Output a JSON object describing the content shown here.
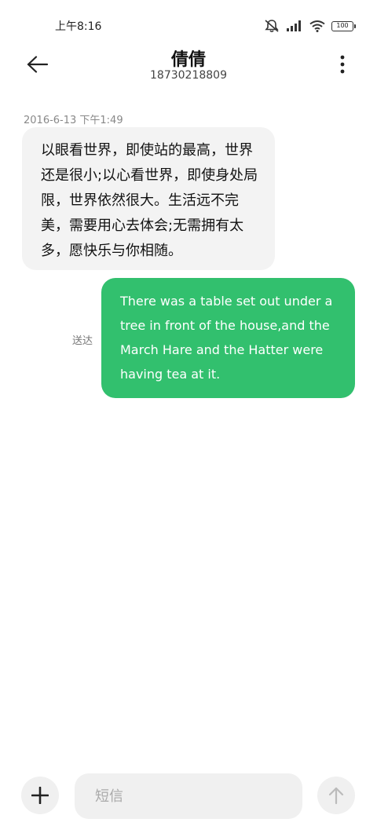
{
  "status_bar": {
    "time": "上午8:16",
    "battery": "100",
    "icons": [
      "mute-bell-icon",
      "signal-icon",
      "wifi-icon",
      "battery-icon"
    ]
  },
  "header": {
    "title": "倩倩",
    "subtitle": "18730218809",
    "back_icon": "back-arrow-icon",
    "menu_icon": "more-vertical-icon"
  },
  "conversation": {
    "timestamp": "2016-6-13 下午1:49",
    "messages": [
      {
        "direction": "incoming",
        "text": "以眼看世界，即使站的最高，世界还是很小;以心看世界，即使身处局限，世界依然很大。生活远不完美，需要用心去体会;无需拥有太多，愿快乐与你相随。"
      },
      {
        "direction": "outgoing",
        "status": "送达",
        "text": "There was a table set out under a tree in front of the house,and the March Hare and the Hatter were having tea at it."
      }
    ]
  },
  "compose": {
    "placeholder": "短信",
    "value": "",
    "add_icon": "plus-icon",
    "send_icon": "send-arrow-icon"
  },
  "colors": {
    "outgoing_bubble": "#32c06e",
    "incoming_bubble": "#f3f3f3",
    "compose_background": "#f0f0f0"
  }
}
